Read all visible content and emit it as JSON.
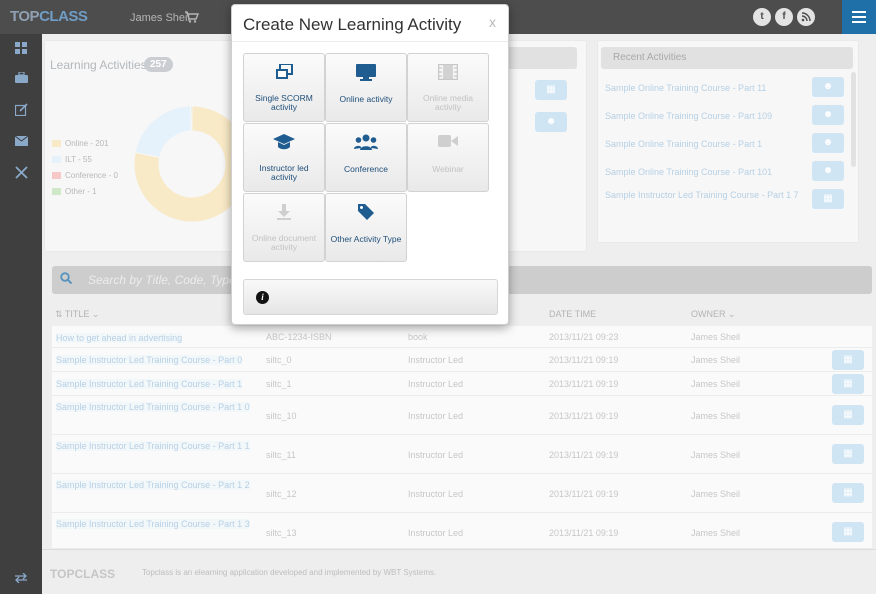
{
  "header": {
    "logo_part1": "TOP",
    "logo_part2": "CLASS",
    "user_name": "James Sheil",
    "icons": [
      "cart-icon",
      "twitter-icon",
      "facebook-icon",
      "rss-icon",
      "menu-icon"
    ]
  },
  "sidebar": {
    "icons": [
      "dashboard-icon",
      "briefcase-icon",
      "edit-icon",
      "mail-icon",
      "tools-icon",
      "switch-icon"
    ]
  },
  "learning_activities": {
    "title": "Learning Activities",
    "count": "257",
    "legend": [
      {
        "label": "Online - 201",
        "color": "#f7e3b5"
      },
      {
        "label": "ILT - 55",
        "color": "#dcecfa"
      },
      {
        "label": "Conference - 0",
        "color": "#f4b6b6"
      },
      {
        "label": "Other - 1",
        "color": "#bfe0b5"
      }
    ],
    "donut": [
      {
        "name": "Online",
        "value": 201,
        "color": "#f7e3b5"
      },
      {
        "name": "ILT",
        "value": 55,
        "color": "#dcecfa"
      },
      {
        "name": "Conference",
        "value": 0,
        "color": "#f4b6b6"
      },
      {
        "name": "Other",
        "value": 1,
        "color": "#bfe0b5"
      }
    ]
  },
  "recent_activities": {
    "title": "Recent Activities",
    "items": [
      "Sample Online Training Course - Part 11",
      "Sample Online Training Course - Part 109",
      "Sample Online Training Course - Part 1",
      "Sample Online Training Course - Part 101",
      "Sample Instructor Led Training Course - Part 1 7"
    ]
  },
  "search": {
    "placeholder": "Search by Title, Code, Type..."
  },
  "table": {
    "columns": {
      "title": "TITLE",
      "date_time": "DATE TIME",
      "owner": "OWNER"
    },
    "rows": [
      {
        "title": "How to get ahead in advertising",
        "code": "ABC-1234-ISBN",
        "type": "book",
        "date": "2013/11/21 09:23",
        "owner": "James Sheil"
      },
      {
        "title": "Sample Instructor Led Training Course - Part 0",
        "code": "siltc_0",
        "type": "Instructor Led",
        "date": "2013/11/21 09:19",
        "owner": "James Sheil"
      },
      {
        "title": "Sample Instructor Led Training Course - Part 1",
        "code": "siltc_1",
        "type": "Instructor Led",
        "date": "2013/11/21 09:19",
        "owner": "James Sheil"
      },
      {
        "title": "Sample Instructor Led Training Course - Part 1 0",
        "code": "siltc_10",
        "type": "Instructor Led",
        "date": "2013/11/21 09:19",
        "owner": "James Sheil"
      },
      {
        "title": "Sample Instructor Led Training Course - Part 1 1",
        "code": "siltc_11",
        "type": "Instructor Led",
        "date": "2013/11/21 09:19",
        "owner": "James Sheil"
      },
      {
        "title": "Sample Instructor Led Training Course - Part 1 2",
        "code": "siltc_12",
        "type": "Instructor Led",
        "date": "2013/11/21 09:19",
        "owner": "James Sheil"
      },
      {
        "title": "Sample Instructor Led Training Course - Part 1 3",
        "code": "siltc_13",
        "type": "Instructor Led",
        "date": "2013/11/21 09:19",
        "owner": "James Sheil"
      }
    ]
  },
  "footer": {
    "logo": "TOPCLASS",
    "text": "Topclass is an elearning application developed and implemented by WBT Systems."
  },
  "modal": {
    "title": "Create New Learning Activity",
    "close": "x",
    "tiles": [
      {
        "label": "Single SCORM activity",
        "icon": "scorm-icon",
        "enabled": true
      },
      {
        "label": "Online activity",
        "icon": "monitor-icon",
        "enabled": true
      },
      {
        "label": "Online media activity",
        "icon": "film-icon",
        "enabled": false
      },
      {
        "label": "Instructor led activity",
        "icon": "graduation-cap-icon",
        "enabled": true
      },
      {
        "label": "Conference",
        "icon": "group-icon",
        "enabled": true
      },
      {
        "label": "Webinar",
        "icon": "video-camera-icon",
        "enabled": false
      },
      {
        "label": "Online document activity",
        "icon": "download-icon",
        "enabled": false
      },
      {
        "label": "Other Activity Type",
        "icon": "tag-icon",
        "enabled": true
      }
    ],
    "info_icon": "info-icon",
    "colors": {
      "accent": "#1f6fa8",
      "disabled": "#c2c2c2"
    }
  }
}
